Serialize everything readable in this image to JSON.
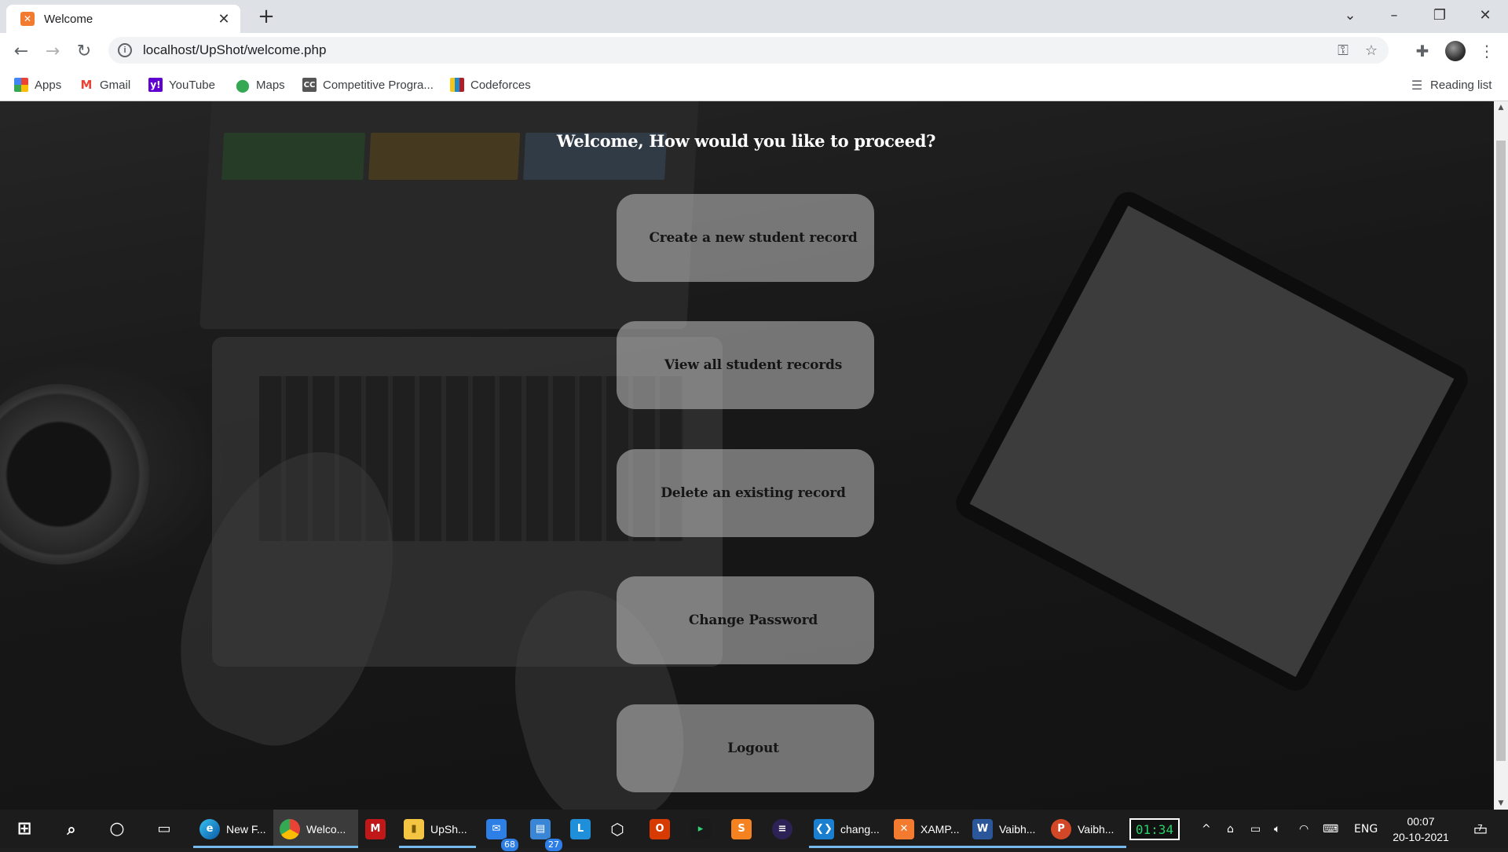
{
  "browser": {
    "tab_title": "Welcome",
    "tab_favicon": "xampp-icon",
    "url": "localhost/UpShot/welcome.php",
    "bookmarks": [
      {
        "label": "Apps",
        "icon": "apps-grid-icon"
      },
      {
        "label": "Gmail",
        "icon": "gmail-icon"
      },
      {
        "label": "YouTube",
        "icon": "yahoo-icon"
      },
      {
        "label": "Maps",
        "icon": "maps-pin-icon"
      },
      {
        "label": "Competitive Progra...",
        "icon": "cc-icon"
      },
      {
        "label": "Codeforces",
        "icon": "codeforces-icon"
      }
    ],
    "reading_list": "Reading list"
  },
  "page": {
    "heading": "Welcome, How would you like to proceed?",
    "options": [
      {
        "label": "Create a new student record"
      },
      {
        "label": "View all student records"
      },
      {
        "label": "Delete an existing record"
      },
      {
        "label": "Change Password"
      },
      {
        "label": "Logout"
      }
    ],
    "button_color": "#d2d2d2"
  },
  "taskbar": {
    "apps": [
      {
        "label": "New F...",
        "icon": "edge-icon"
      },
      {
        "label": "Welco...",
        "icon": "chrome-icon",
        "active": true
      },
      {
        "label": "",
        "icon": "mcafee-icon"
      },
      {
        "label": "UpSh...",
        "icon": "folder-icon"
      },
      {
        "label": "",
        "icon": "mail-icon",
        "badge": "68"
      },
      {
        "label": "",
        "icon": "calendar-icon",
        "badge": "27"
      },
      {
        "label": "",
        "icon": "l-app-icon"
      },
      {
        "label": "",
        "icon": "3d-box-icon"
      },
      {
        "label": "",
        "icon": "office-icon"
      },
      {
        "label": "",
        "icon": "arrow-app-icon"
      },
      {
        "label": "",
        "icon": "sublime-icon"
      },
      {
        "label": "",
        "icon": "eclipse-icon"
      },
      {
        "label": "chang...",
        "icon": "vscode-icon"
      },
      {
        "label": "XAMP...",
        "icon": "xampp-icon"
      },
      {
        "label": "Vaibh...",
        "icon": "word-icon"
      },
      {
        "label": "Vaibh...",
        "icon": "powerpoint-icon"
      }
    ],
    "timer": "01:34",
    "language": "ENG",
    "time": "00:07",
    "date": "20-10-2021",
    "notifications": "7"
  }
}
